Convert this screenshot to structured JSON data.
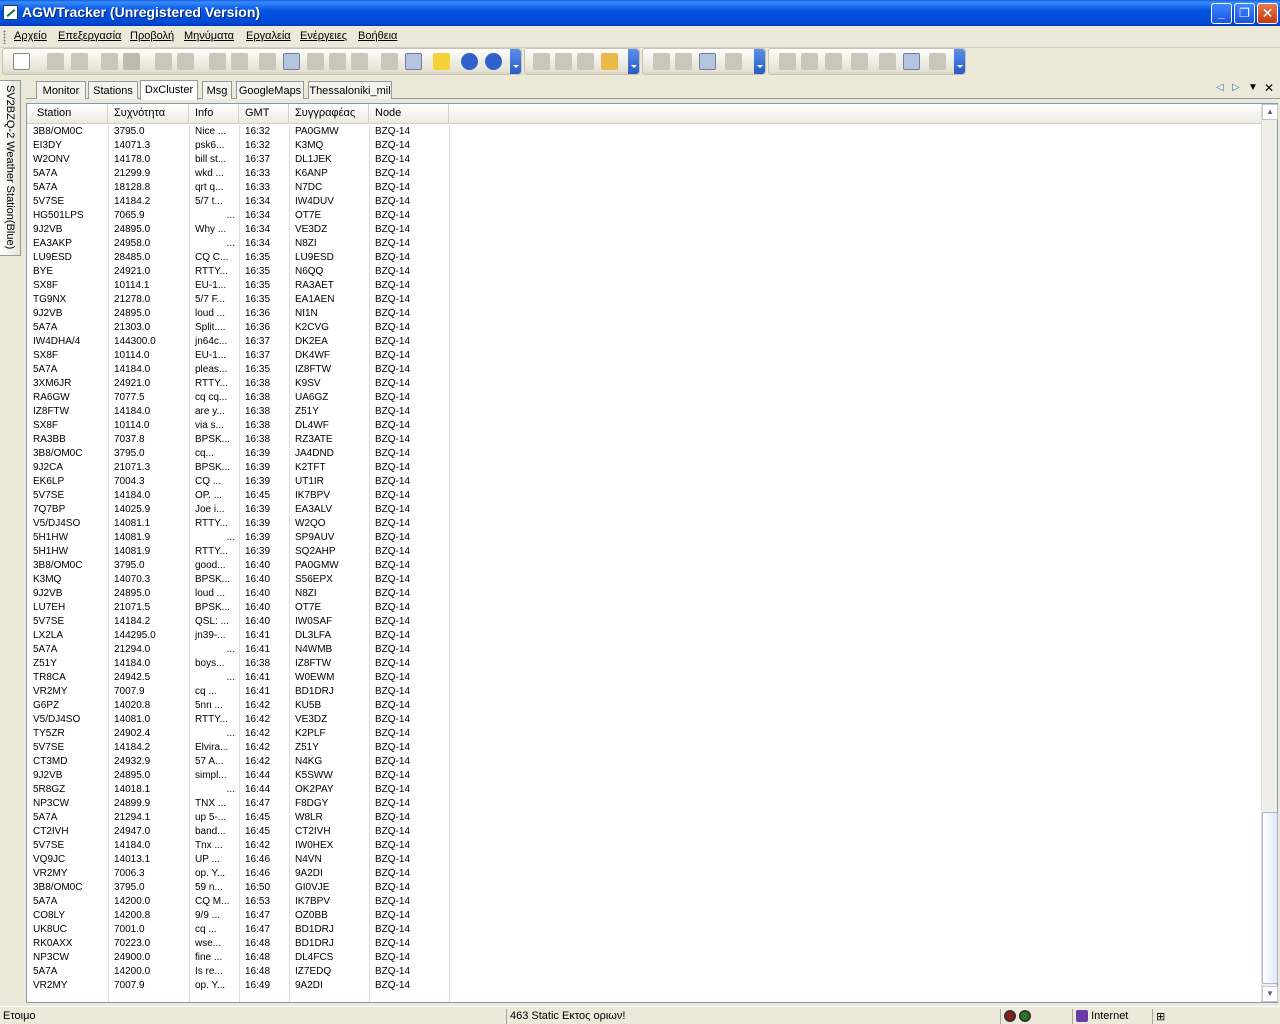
{
  "window": {
    "title": "AGWTracker (Unregistered Version)",
    "buttons": {
      "minimize": "_",
      "restore": "❐",
      "close": "✕"
    }
  },
  "menu": [
    "Αρχείο",
    "Επεξεργασία",
    "Προβολή",
    "Μηνύματα",
    "Εργαλεία",
    "Ενέργειες",
    "Βοήθεια"
  ],
  "side_tab": {
    "label": "SV2BZQ-2 Weather Station(Blue)"
  },
  "tabs": [
    {
      "label": "Monitor"
    },
    {
      "label": "Stations"
    },
    {
      "label": "DxCluster",
      "active": true
    },
    {
      "label": "Msg"
    },
    {
      "label": "GoogleMaps"
    },
    {
      "label": "Thessaloniki_mil"
    }
  ],
  "tab_nav": {
    "prev": "◁",
    "next": "▷",
    "menu": "▼",
    "close": "✕"
  },
  "columns": [
    "Station",
    "Συχνότητα",
    "Info",
    "GMT",
    "Συγγραφέας",
    "Node"
  ],
  "rows": [
    [
      "3B8/OM0C",
      "3795.0",
      "Nice ...",
      "16:32",
      "PA0GMW",
      "BZQ-14"
    ],
    [
      "EI3DY",
      "14071.3",
      "psk6...",
      "16:32",
      "K3MQ",
      "BZQ-14"
    ],
    [
      "W2ONV",
      "14178.0",
      "bill st...",
      "16:37",
      "DL1JEK",
      "BZQ-14"
    ],
    [
      "5A7A",
      "21299.9",
      "wkd ...",
      "16:33",
      "K6ANP",
      "BZQ-14"
    ],
    [
      "5A7A",
      "18128.8",
      "qrt q...",
      "16:33",
      "N7DC",
      "BZQ-14"
    ],
    [
      "5V7SE",
      "14184.2",
      "5/7 t...",
      "16:34",
      "IW4DUV",
      "BZQ-14"
    ],
    [
      "HG501LPS",
      "7065.9",
      "...",
      "16:34",
      "OT7E",
      "BZQ-14"
    ],
    [
      "9J2VB",
      "24895.0",
      "Why ...",
      "16:34",
      "VE3DZ",
      "BZQ-14"
    ],
    [
      "EA3AKP",
      "24958.0",
      "...",
      "16:34",
      "N8ZI",
      "BZQ-14"
    ],
    [
      "LU9ESD",
      "28485.0",
      "CQ C...",
      "16:35",
      "LU9ESD",
      "BZQ-14"
    ],
    [
      "BYE",
      "24921.0",
      "RTTY...",
      "16:35",
      "N6QQ",
      "BZQ-14"
    ],
    [
      "SX8F",
      "10114.1",
      "EU-1...",
      "16:35",
      "RA3AET",
      "BZQ-14"
    ],
    [
      "TG9NX",
      "21278.0",
      "5/7 F...",
      "16:35",
      "EA1AEN",
      "BZQ-14"
    ],
    [
      "9J2VB",
      "24895.0",
      "loud ...",
      "16:36",
      "NI1N",
      "BZQ-14"
    ],
    [
      "5A7A",
      "21303.0",
      "Split....",
      "16:36",
      "K2CVG",
      "BZQ-14"
    ],
    [
      "IW4DHA/4",
      "144300.0",
      "jn64c...",
      "16:37",
      "DK2EA",
      "BZQ-14"
    ],
    [
      "SX8F",
      "10114.0",
      "EU-1...",
      "16:37",
      "DK4WF",
      "BZQ-14"
    ],
    [
      "5A7A",
      "14184.0",
      "pleas...",
      "16:35",
      "IZ8FTW",
      "BZQ-14"
    ],
    [
      "3XM6JR",
      "24921.0",
      "RTTY...",
      "16:38",
      "K9SV",
      "BZQ-14"
    ],
    [
      "RA6GW",
      "7077.5",
      "cq cq...",
      "16:38",
      "UA6GZ",
      "BZQ-14"
    ],
    [
      "IZ8FTW",
      "14184.0",
      "are y...",
      "16:38",
      "Z51Y",
      "BZQ-14"
    ],
    [
      "SX8F",
      "10114.0",
      "via s...",
      "16:38",
      "DL4WF",
      "BZQ-14"
    ],
    [
      "RA3BB",
      "7037.8",
      "BPSK...",
      "16:38",
      "RZ3ATE",
      "BZQ-14"
    ],
    [
      "3B8/OM0C",
      "3795.0",
      "cq...",
      "16:39",
      "JA4DND",
      "BZQ-14"
    ],
    [
      "9J2CA",
      "21071.3",
      "BPSK...",
      "16:39",
      "K2TFT",
      "BZQ-14"
    ],
    [
      "EK6LP",
      "7004.3",
      "CQ ...",
      "16:39",
      "UT1IR",
      "BZQ-14"
    ],
    [
      "5V7SE",
      "14184.0",
      "OP. ...",
      "16:45",
      "IK7BPV",
      "BZQ-14"
    ],
    [
      "7Q7BP",
      "14025.9",
      "Joe i...",
      "16:39",
      "EA3ALV",
      "BZQ-14"
    ],
    [
      "V5/DJ4SO",
      "14081.1",
      "RTTY...",
      "16:39",
      "W2QO",
      "BZQ-14"
    ],
    [
      "5H1HW",
      "14081.9",
      "...",
      "16:39",
      "SP9AUV",
      "BZQ-14"
    ],
    [
      "5H1HW",
      "14081.9",
      "RTTY...",
      "16:39",
      "SQ2AHP",
      "BZQ-14"
    ],
    [
      "3B8/OM0C",
      "3795.0",
      "good...",
      "16:40",
      "PA0GMW",
      "BZQ-14"
    ],
    [
      "K3MQ",
      "14070.3",
      "BPSK...",
      "16:40",
      "S56EPX",
      "BZQ-14"
    ],
    [
      "9J2VB",
      "24895.0",
      "loud ...",
      "16:40",
      "N8ZI",
      "BZQ-14"
    ],
    [
      "LU7EH",
      "21071.5",
      "BPSK...",
      "16:40",
      "OT7E",
      "BZQ-14"
    ],
    [
      "5V7SE",
      "14184.2",
      "QSL: ...",
      "16:40",
      "IW0SAF",
      "BZQ-14"
    ],
    [
      "LX2LA",
      "144295.0",
      "jn39-...",
      "16:41",
      "DL3LFA",
      "BZQ-14"
    ],
    [
      "5A7A",
      "21294.0",
      "...",
      "16:41",
      "N4WMB",
      "BZQ-14"
    ],
    [
      "Z51Y",
      "14184.0",
      "boys...",
      "16:38",
      "IZ8FTW",
      "BZQ-14"
    ],
    [
      "TR8CA",
      "24942.5",
      "...",
      "16:41",
      "W0EWM",
      "BZQ-14"
    ],
    [
      "VR2MY",
      "7007.9",
      "cq ...",
      "16:41",
      "BD1DRJ",
      "BZQ-14"
    ],
    [
      "G6PZ",
      "14020.8",
      "5nn ...",
      "16:42",
      "KU5B",
      "BZQ-14"
    ],
    [
      "V5/DJ4SO",
      "14081.0",
      "RTTY...",
      "16:42",
      "VE3DZ",
      "BZQ-14"
    ],
    [
      "TY5ZR",
      "24902.4",
      "...",
      "16:42",
      "K2PLF",
      "BZQ-14"
    ],
    [
      "5V7SE",
      "14184.2",
      "Elvira...",
      "16:42",
      "Z51Y",
      "BZQ-14"
    ],
    [
      "CT3MD",
      "24932.9",
      "57 A...",
      "16:42",
      "N4KG",
      "BZQ-14"
    ],
    [
      "9J2VB",
      "24895.0",
      "simpl...",
      "16:44",
      "K5SWW",
      "BZQ-14"
    ],
    [
      "5R8GZ",
      "14018.1",
      "...",
      "16:44",
      "OK2PAY",
      "BZQ-14"
    ],
    [
      "NP3CW",
      "24899.9",
      "TNX ...",
      "16:47",
      "F8DGY",
      "BZQ-14"
    ],
    [
      "5A7A",
      "21294.1",
      "up 5-...",
      "16:45",
      "W8LR",
      "BZQ-14"
    ],
    [
      "CT2IVH",
      "24947.0",
      "band...",
      "16:45",
      "CT2IVH",
      "BZQ-14"
    ],
    [
      "5V7SE",
      "14184.0",
      "Tnx ...",
      "16:42",
      "IW0HEX",
      "BZQ-14"
    ],
    [
      "VQ9JC",
      "14013.1",
      "UP ...",
      "16:46",
      "N4VN",
      "BZQ-14"
    ],
    [
      "VR2MY",
      "7006.3",
      "op. Y...",
      "16:46",
      "9A2DI",
      "BZQ-14"
    ],
    [
      "3B8/OM0C",
      "3795.0",
      "59 n...",
      "16:50",
      "GI0VJE",
      "BZQ-14"
    ],
    [
      "5A7A",
      "14200.0",
      "CQ M...",
      "16:53",
      "IK7BPV",
      "BZQ-14"
    ],
    [
      "CO8LY",
      "14200.8",
      "9/9 ...",
      "16:47",
      "OZ0BB",
      "BZQ-14"
    ],
    [
      "UK8UC",
      "7001.0",
      "cq ...",
      "16:47",
      "BD1DRJ",
      "BZQ-14"
    ],
    [
      "RK0AXX",
      "70223.0",
      "wse...",
      "16:48",
      "BD1DRJ",
      "BZQ-14"
    ],
    [
      "NP3CW",
      "24900.0",
      "fine ...",
      "16:48",
      "DL4FCS",
      "BZQ-14"
    ],
    [
      "5A7A",
      "14200.0",
      "Is re...",
      "16:48",
      "IZ7EDQ",
      "BZQ-14"
    ],
    [
      "VR2MY",
      "7007.9",
      "op. Y...",
      "16:49",
      "9A2DI",
      "BZQ-14"
    ]
  ],
  "status": {
    "ready": "Ετοιμο",
    "stations": "463 Static Εκτος οριων!",
    "zone": "Internet"
  },
  "colors": {
    "title_bar": "#0355e3",
    "grid_bg": "#ffffff",
    "chrome": "#ece9d8"
  }
}
